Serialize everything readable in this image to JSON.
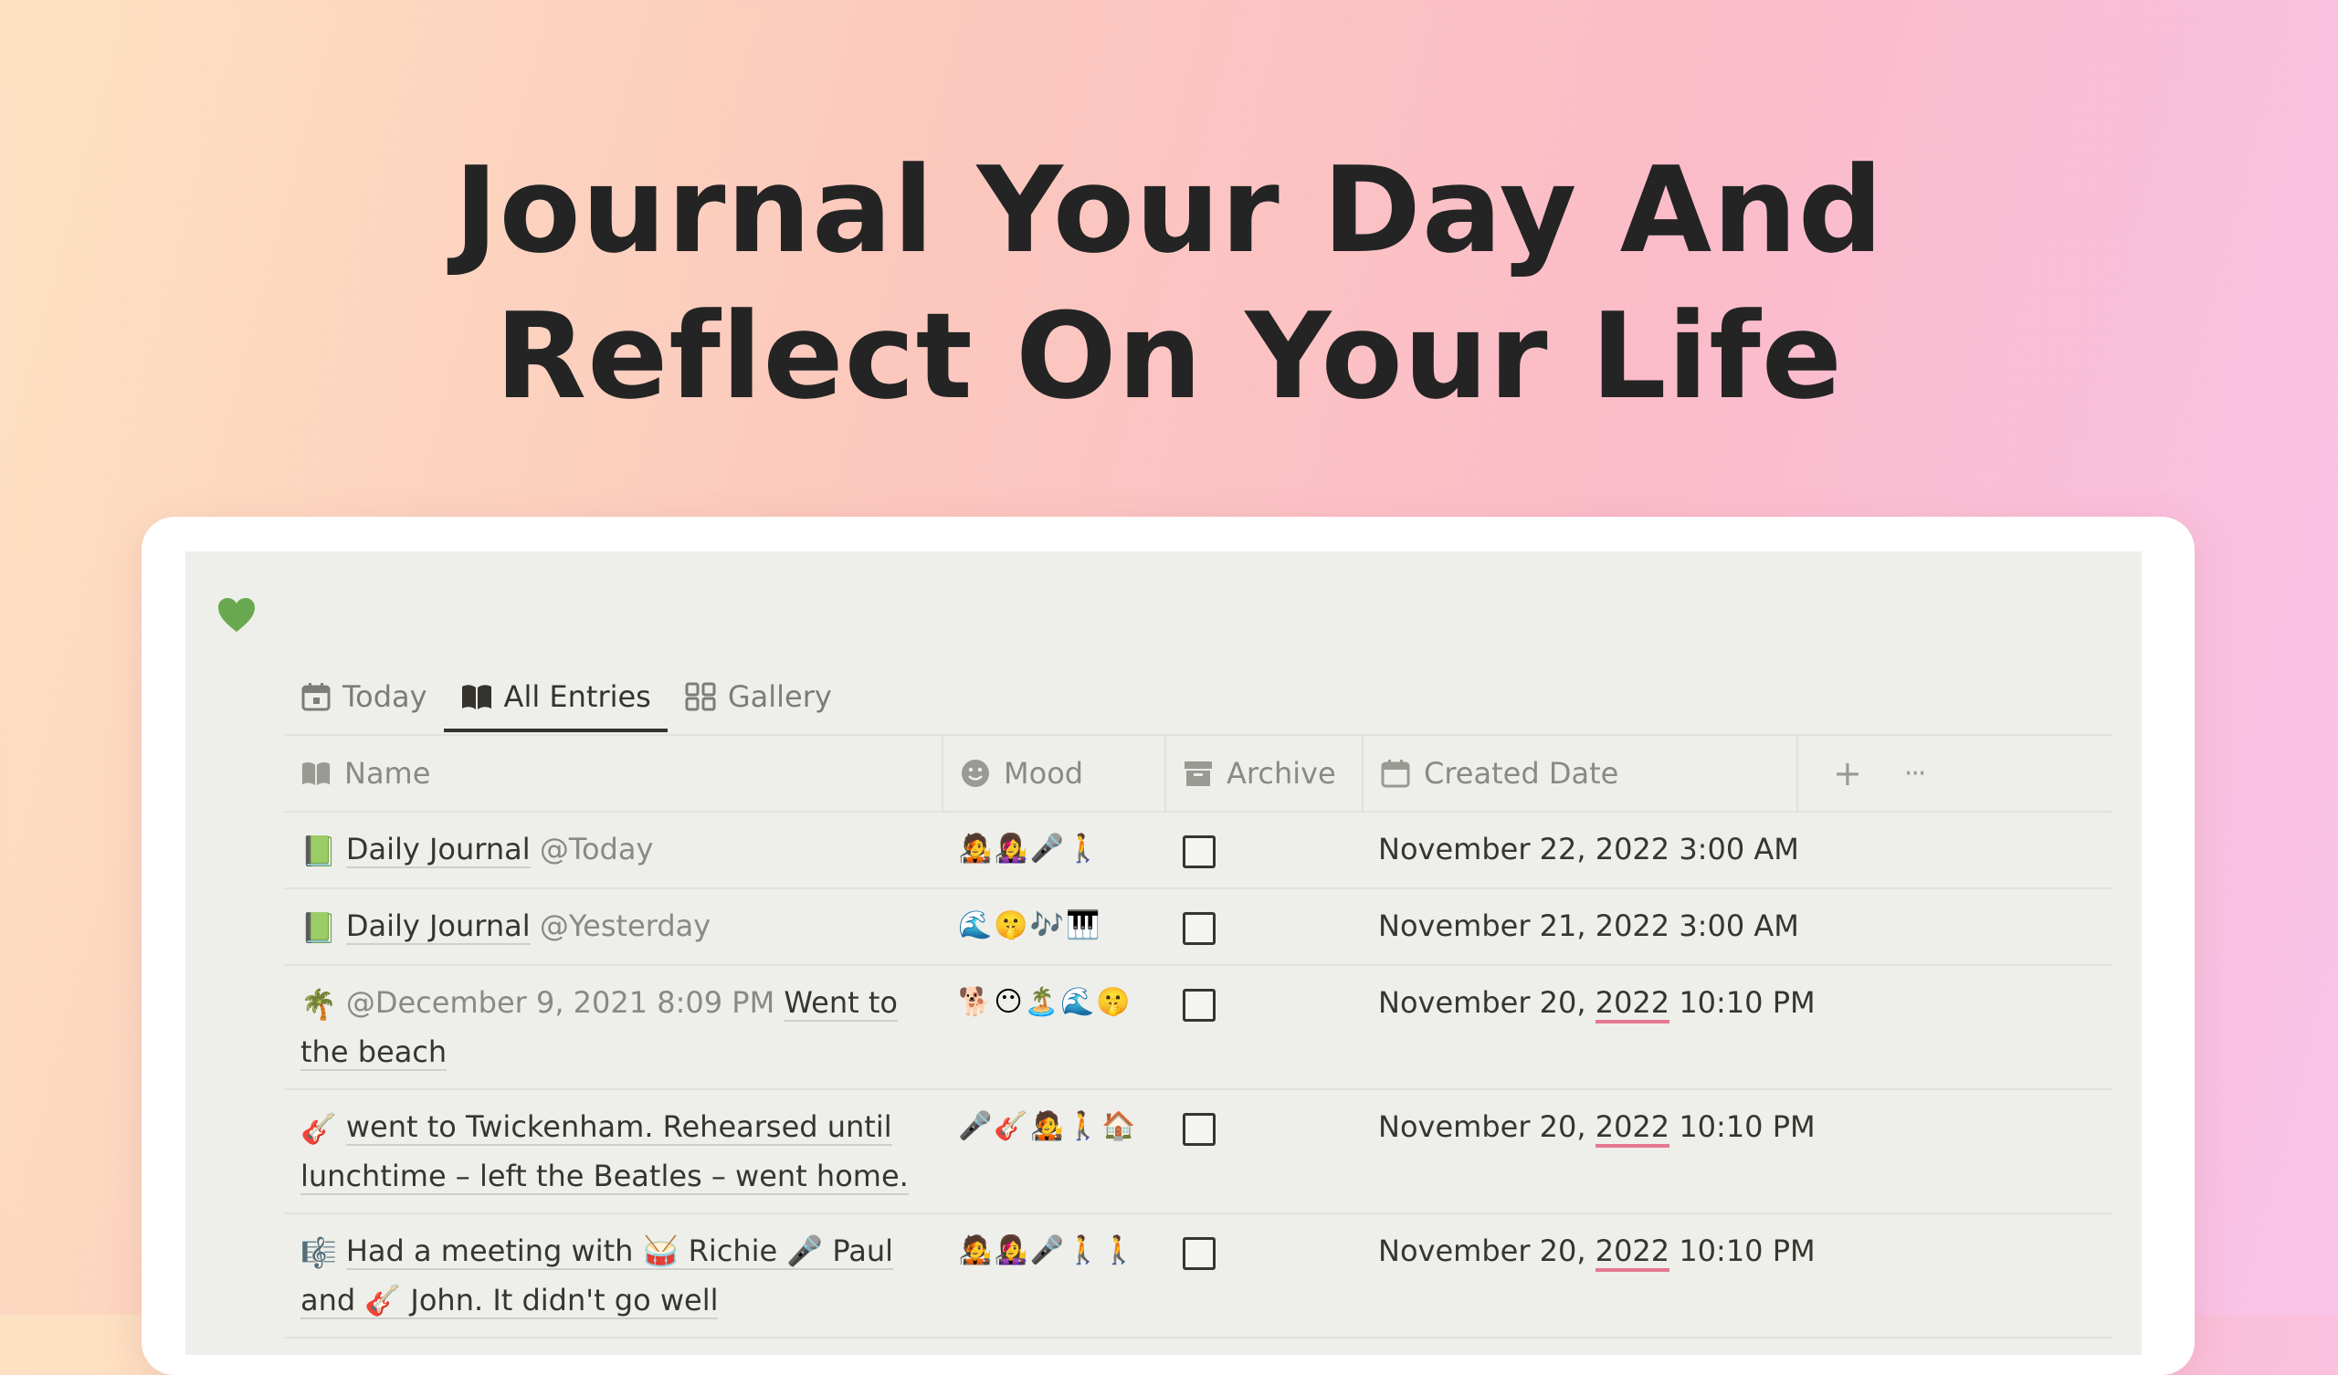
{
  "headline": {
    "line1": "Journal Your Day And",
    "line2": "Reflect On Your Life"
  },
  "colors": {
    "accent_heart": "#6aa84f",
    "date_underline": "#e4788f",
    "text": "#37352f"
  },
  "page_icon": "green-heart-icon",
  "tabs": [
    {
      "label": "Today",
      "icon": "calendar-icon",
      "active": false
    },
    {
      "label": "All Entries",
      "icon": "open-book-icon",
      "active": true
    },
    {
      "label": "Gallery",
      "icon": "grid-icon",
      "active": false
    }
  ],
  "columns": {
    "name": "Name",
    "mood": "Mood",
    "archive": "Archive",
    "created": "Created Date",
    "add": "+",
    "more": "···"
  },
  "rows": [
    {
      "icon": "📗",
      "mention": "",
      "title": "Daily Journal",
      "trail_mention": "@Today",
      "mood": "🧑‍🎤👩‍🎤🎤🚶",
      "archived": false,
      "date_prefix": "November 22, ",
      "date_year": "2022",
      "date_time": " 3:00 AM",
      "year_underlined": false
    },
    {
      "icon": "📗",
      "mention": "",
      "title": "Daily Journal",
      "trail_mention": "@Yesterday",
      "mood": "🌊🤫🎶🎹",
      "archived": false,
      "date_prefix": "November 21, ",
      "date_year": "2022",
      "date_time": " 3:00 AM",
      "year_underlined": false
    },
    {
      "icon": "🌴",
      "mention": "@December 9, 2021 8:09 PM",
      "title": "Went to the beach",
      "trail_mention": "",
      "mood": "🐕😶🏝️🌊🤫",
      "archived": false,
      "date_prefix": "November 20, ",
      "date_year": "2022",
      "date_time": " 10:10 PM",
      "year_underlined": true
    },
    {
      "icon": "🎸",
      "mention": "",
      "title": "went to Twickenham. Rehearsed until lunchtime – left the Beatles – went home.",
      "trail_mention": "",
      "mood": "🎤🎸🧑‍🎤🚶🏠",
      "archived": false,
      "date_prefix": "November 20, ",
      "date_year": "2022",
      "date_time": " 10:10 PM",
      "year_underlined": true
    },
    {
      "icon": "🎼",
      "mention": "",
      "title": "Had a meeting with 🥁 Richie 🎤 Paul and 🎸 John. It didn't go well",
      "trail_mention": "",
      "mood": "🧑‍🎤👩‍🎤🎤🚶🚶",
      "archived": false,
      "date_prefix": "November 20, ",
      "date_year": "2022",
      "date_time": " 10:10 PM",
      "year_underlined": true
    }
  ]
}
